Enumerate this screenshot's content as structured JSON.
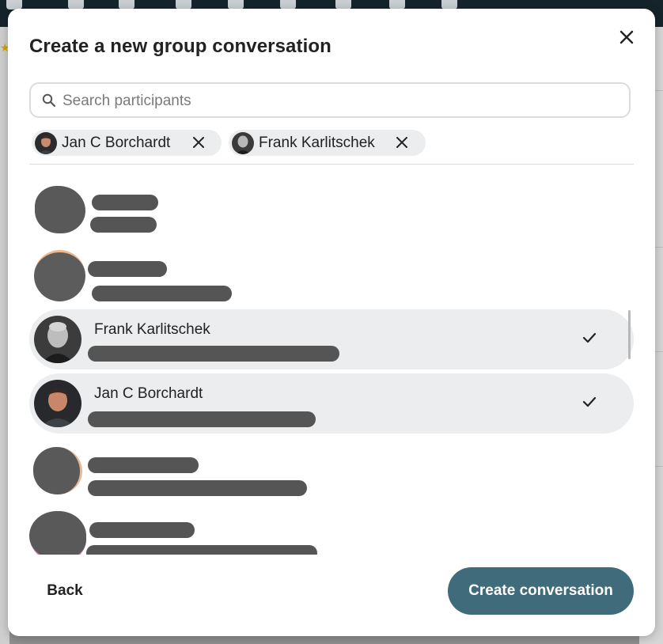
{
  "dialog": {
    "title": "Create a new group conversation",
    "close_icon": "close-icon"
  },
  "search": {
    "placeholder": "Search participants",
    "value": "",
    "icon": "search-icon"
  },
  "selected_participants": [
    {
      "name": "Jan C Borchardt",
      "remove_icon": "close-icon"
    },
    {
      "name": "Frank Karlitschek",
      "remove_icon": "close-icon"
    }
  ],
  "participants": [
    {
      "name": "",
      "email": "",
      "selected": false,
      "redacted": true
    },
    {
      "name": "",
      "email": "",
      "selected": false,
      "redacted": true
    },
    {
      "name": "Frank Karlitschek",
      "email": "",
      "selected": true,
      "redacted_email": true
    },
    {
      "name": "Jan C Borchardt",
      "email": "",
      "selected": true,
      "redacted_email": true
    },
    {
      "name": "",
      "email": "",
      "selected": false,
      "redacted": true
    },
    {
      "name": "",
      "email": "",
      "selected": false,
      "redacted": true
    }
  ],
  "footer": {
    "back_label": "Back",
    "create_label": "Create conversation"
  },
  "colors": {
    "primary": "#3f6b7b",
    "selected_row": "#ebedef",
    "redaction": "#555555"
  }
}
